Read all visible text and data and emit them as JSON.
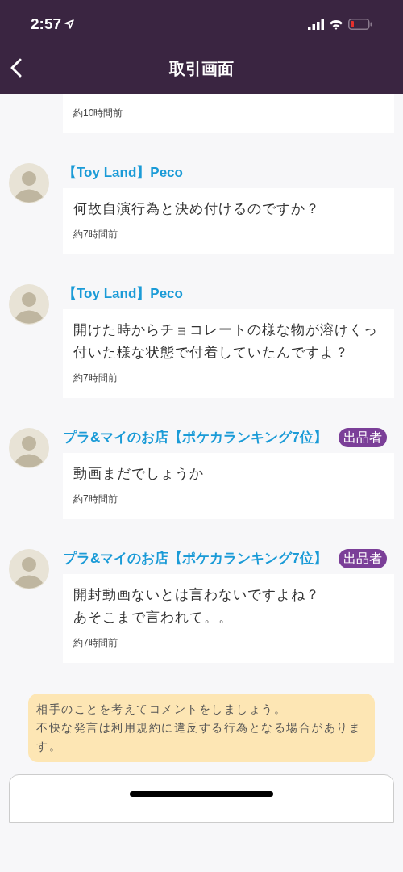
{
  "status_bar": {
    "time": "2:57"
  },
  "header": {
    "title": "取引画面"
  },
  "messages": [
    {
      "time": "約10時間前"
    },
    {
      "sender": "【Toy Land】Peco",
      "text": "何故自演行為と決め付けるのですか？",
      "time": "約7時間前"
    },
    {
      "sender": "【Toy Land】Peco",
      "text": "開けた時からチョコレートの様な物が溶けくっ付いた様な状態で付着していたんですよ？",
      "time": "約7時間前"
    },
    {
      "sender": "プラ&マイのお店【ポケカランキング7位】",
      "badge": "出品者",
      "text": "動画まだでしょうか",
      "time": "約7時間前"
    },
    {
      "sender": "プラ&マイのお店【ポケカランキング7位】",
      "badge": "出品者",
      "text": [
        "開封動画ないとは言わないですよね？",
        "あそこまで言われて。。"
      ],
      "time": "約7時間前"
    }
  ],
  "notice": {
    "lines": [
      "相手のことを考えてコメントをしましょう。",
      "不快な発言は利用規約に違反する行為となる場合があります。"
    ]
  }
}
